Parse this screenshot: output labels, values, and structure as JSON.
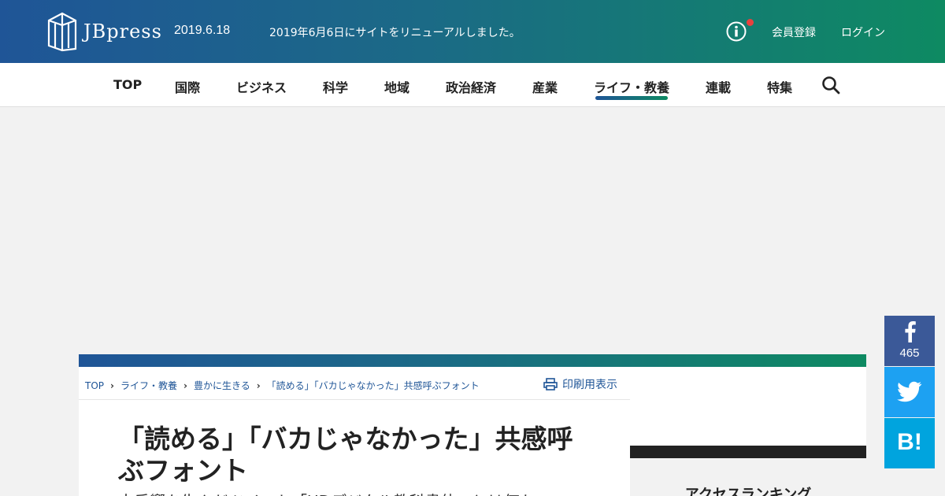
{
  "header": {
    "logo_text": "JBpress",
    "date": "2019.6.18",
    "notice": "2019年6月6日にサイトをリニューアルしました。",
    "member_label": "会員登録",
    "login_label": "ログイン",
    "notification_color": "#e8413e"
  },
  "nav": {
    "items": [
      {
        "label": "TOP"
      },
      {
        "label": "国際"
      },
      {
        "label": "ビジネス"
      },
      {
        "label": "科学"
      },
      {
        "label": "地域"
      },
      {
        "label": "政治経済"
      },
      {
        "label": "産業"
      },
      {
        "label": "ライフ・教養",
        "active": true
      },
      {
        "label": "連載"
      },
      {
        "label": "特集"
      }
    ],
    "search_icon": "search-icon"
  },
  "breadcrumb": {
    "items": [
      "TOP",
      "ライフ・教養",
      "豊かに生きる",
      "「読める」「バカじゃなかった」共感呼ぶフォント"
    ]
  },
  "article": {
    "print_label": "印刷用表示",
    "title": "「読める」「バカじゃなかった」共感呼ぶフォント",
    "subtitle": "大反響を生んだツイート「UDデジタル教科書体」とは何か"
  },
  "sidebar": {
    "ranking_title": "アクセスランキング"
  },
  "share": {
    "facebook_count": "465",
    "hatena_label": "B!",
    "facebook_color": "#3b5998",
    "twitter_color": "#1da1f2",
    "hatena_color": "#00a4de"
  },
  "colors": {
    "brand_blue": "#1f5597",
    "brand_green": "#0e8a62"
  }
}
